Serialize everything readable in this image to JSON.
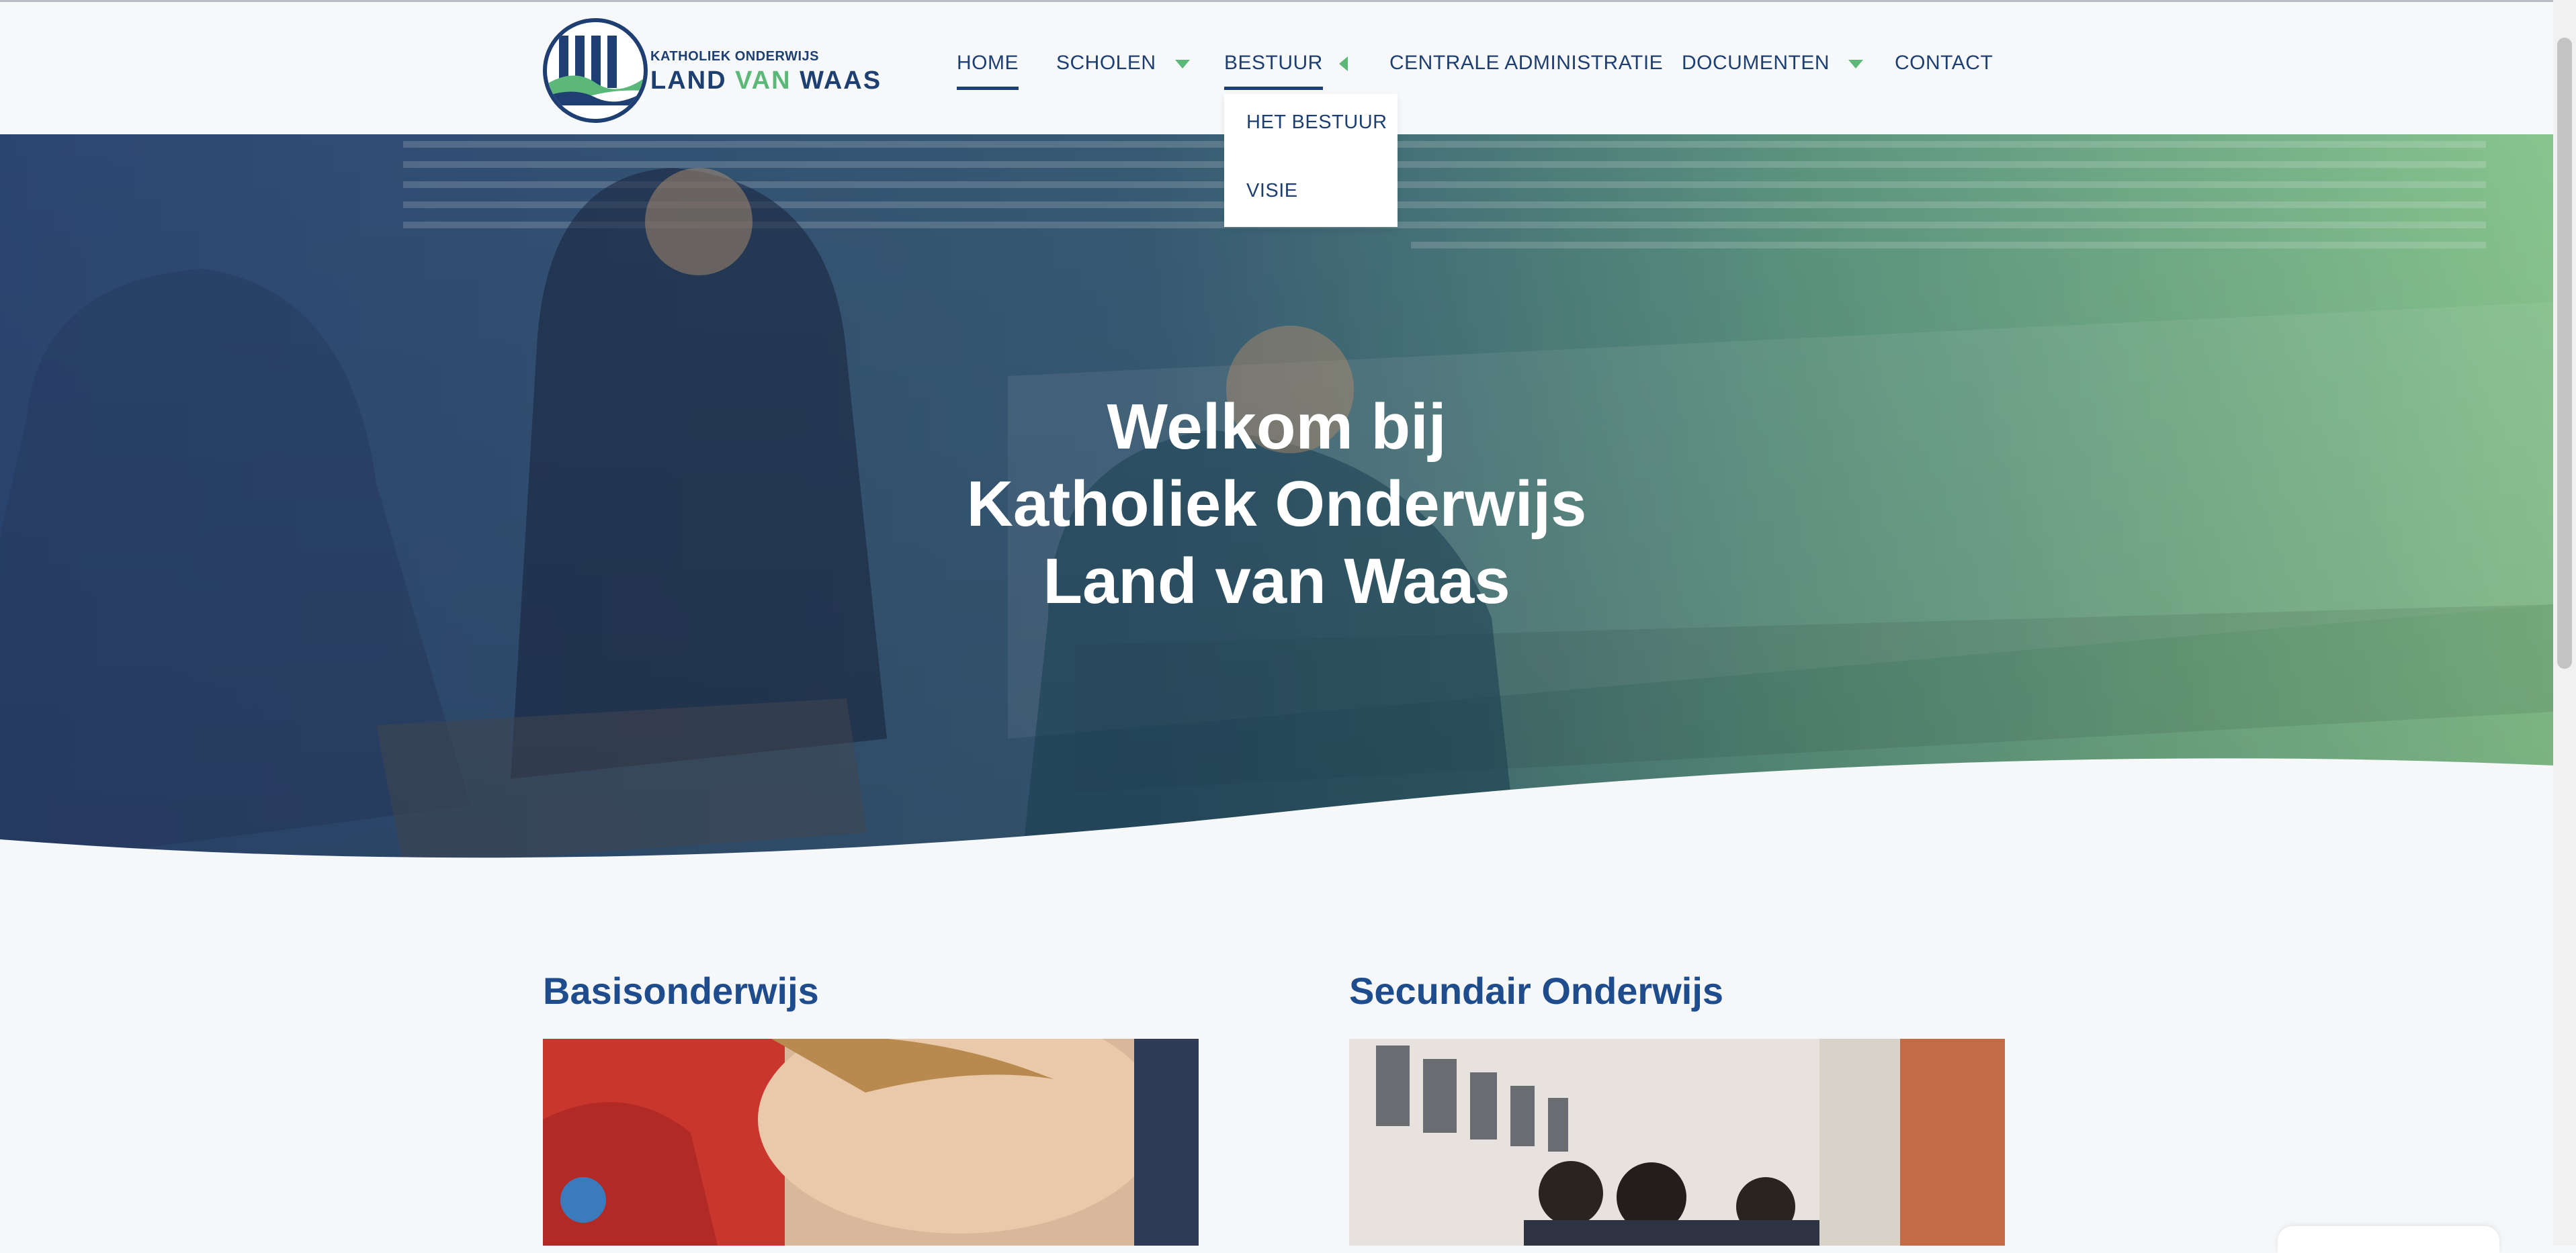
{
  "header": {
    "logo": {
      "line1": "KATHOLIEK ONDERWIJS",
      "line2_a": "LAND ",
      "line2_b": "VAN",
      "line2_c": " WAAS",
      "colors": {
        "navy": "#1f3f73",
        "green": "#5cb879"
      }
    },
    "nav": [
      {
        "label": "HOME",
        "active": true
      },
      {
        "label": "SCHOLEN",
        "icon": "chevron-down-icon"
      },
      {
        "label": "BESTUUR",
        "icon": "chevron-left-icon",
        "open": true
      },
      {
        "label": "CENTRALE ADMINISTRATIE"
      },
      {
        "label": "DOCUMENTEN",
        "icon": "chevron-down-icon"
      },
      {
        "label": "CONTACT"
      }
    ],
    "dropdown": [
      "HET BESTUUR",
      "VISIE"
    ]
  },
  "hero": {
    "title_lines": [
      "Welkom bij",
      "Katholiek Onderwijs",
      "Land van Waas"
    ],
    "overlay_colors": [
      "#1e3f72",
      "#5cb879"
    ]
  },
  "sections": [
    {
      "title": "Basisonderwijs"
    },
    {
      "title": "Secundair Onderwijs"
    }
  ],
  "colors": {
    "text": "#1e3f72",
    "accent": "#5cb879",
    "background": "#f5f7f9"
  }
}
